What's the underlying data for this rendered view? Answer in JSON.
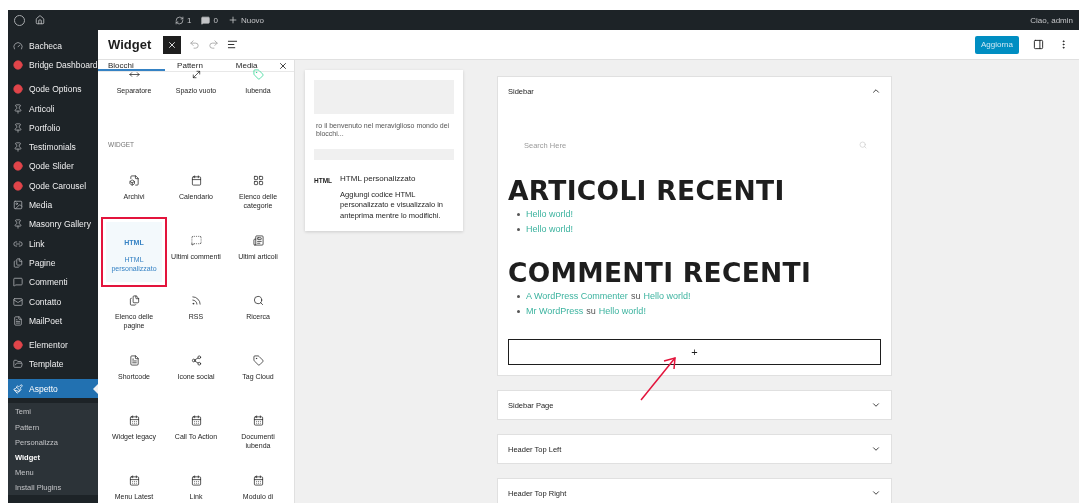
{
  "admin_bar": {
    "updates": "1",
    "comments": "0",
    "new_label": "Nuovo",
    "greeting": "Ciao, admin"
  },
  "admin_menu": {
    "groups": [
      [
        {
          "label": "Bacheca",
          "selected": false
        },
        {
          "label": "Bridge Dashboard",
          "selected": false
        }
      ],
      [
        {
          "label": "Qode Options",
          "selected": false
        },
        {
          "label": "Articoli",
          "selected": false
        },
        {
          "label": "Portfolio",
          "selected": false
        },
        {
          "label": "Testimonials",
          "selected": false
        },
        {
          "label": "Qode Slider",
          "selected": false
        },
        {
          "label": "Qode Carousel",
          "selected": false
        },
        {
          "label": "Media",
          "selected": false
        },
        {
          "label": "Masonry Gallery",
          "selected": false
        },
        {
          "label": "Link",
          "selected": false
        },
        {
          "label": "Pagine",
          "selected": false
        },
        {
          "label": "Commenti",
          "selected": false
        },
        {
          "label": "Contatto",
          "selected": false
        },
        {
          "label": "MailPoet",
          "selected": false
        }
      ],
      [
        {
          "label": "Elementor",
          "selected": false
        },
        {
          "label": "Template",
          "selected": false
        }
      ],
      [
        {
          "label": "Aspetto",
          "selected": true
        }
      ]
    ],
    "submenu": [
      {
        "label": "Temi",
        "selected": false
      },
      {
        "label": "Pattern",
        "selected": false
      },
      {
        "label": "Personalizza",
        "selected": false
      },
      {
        "label": "Widget",
        "selected": true
      },
      {
        "label": "Menu",
        "selected": false
      },
      {
        "label": "Install Plugins",
        "selected": false
      }
    ]
  },
  "editor_header": {
    "title": "Widget",
    "inserter_open": true,
    "update_button": "Aggiorna"
  },
  "inserter": {
    "tabs": [
      {
        "label": "Blocchi",
        "selected": true
      },
      {
        "label": "Pattern",
        "selected": false
      },
      {
        "label": "Media",
        "selected": false
      }
    ],
    "top_blocks": [
      {
        "label": "Separatore",
        "highlighted": false
      },
      {
        "label": "Spazio vuoto",
        "highlighted": false
      },
      {
        "label": "Iubenda",
        "highlighted": false
      }
    ],
    "section_title": "WIDGET",
    "blocks": [
      {
        "label": "Archivi",
        "highlighted": false
      },
      {
        "label": "Calendario",
        "highlighted": false
      },
      {
        "label": "Elenco delle categorie",
        "highlighted": false
      },
      {
        "label": "HTML personalizzato",
        "highlighted": true,
        "badge": "HTML"
      },
      {
        "label": "Ultimi commenti",
        "highlighted": false
      },
      {
        "label": "Ultimi articoli",
        "highlighted": false
      },
      {
        "label": "Elenco delle pagine",
        "highlighted": false
      },
      {
        "label": "RSS",
        "highlighted": false
      },
      {
        "label": "Ricerca",
        "highlighted": false
      },
      {
        "label": "Shortcode",
        "highlighted": false
      },
      {
        "label": "Icone social",
        "highlighted": false
      },
      {
        "label": "Tag Cloud",
        "highlighted": false
      },
      {
        "label": "Widget legacy",
        "highlighted": false
      },
      {
        "label": "Call To Action",
        "highlighted": false
      },
      {
        "label": "Documenti iubenda",
        "highlighted": false
      },
      {
        "label": "Menu Latest",
        "highlighted": false
      },
      {
        "label": "Link",
        "highlighted": false
      },
      {
        "label": "Modulo di",
        "highlighted": false
      }
    ]
  },
  "preview": {
    "sample_text": "ro il benvenuto nel meraviglioso mondo dei blocchi...",
    "badge": "HTML",
    "title": "HTML personalizzato",
    "description": "Aggiungi codice HTML personalizzato e visualizzalo in anteprima mentre lo modifichi."
  },
  "widget_areas": [
    {
      "title": "Sidebar",
      "expanded": true,
      "search_placeholder": "Search Here",
      "sections": [
        {
          "heading": "ARTICOLI RECENTI",
          "items": [
            {
              "parts": [
                {
                  "text": "Hello world!",
                  "link": true
                }
              ]
            },
            {
              "parts": [
                {
                  "text": "Hello world!",
                  "link": true
                }
              ]
            }
          ]
        },
        {
          "heading": "COMMENTI RECENTI",
          "items": [
            {
              "parts": [
                {
                  "text": "A WordPress Commenter",
                  "link": true
                },
                {
                  "text": "su",
                  "link": false
                },
                {
                  "text": "Hello world!",
                  "link": true
                }
              ]
            },
            {
              "parts": [
                {
                  "text": "Mr WordPress",
                  "link": true
                },
                {
                  "text": "su",
                  "link": false
                },
                {
                  "text": "Hello world!",
                  "link": true
                }
              ]
            }
          ]
        }
      ],
      "add_block": "+"
    },
    {
      "title": "Sidebar Page",
      "expanded": false
    },
    {
      "title": "Header Top Left",
      "expanded": false
    },
    {
      "title": "Header Top Right",
      "expanded": false
    }
  ]
}
